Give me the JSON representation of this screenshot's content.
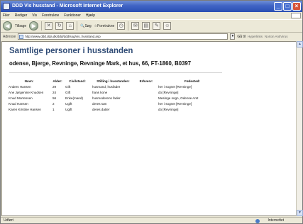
{
  "window": {
    "title": "DDD Vis husstand - Microsoft Internet Explorer"
  },
  "menu": {
    "items": [
      "Filer",
      "Rediger",
      "Vis",
      "Foretrukne",
      "Funktioner",
      "Hjælp"
    ]
  },
  "toolbar": {
    "back_label": "Tilbage",
    "search_label": "Søg",
    "favorites_label": "Foretrukne"
  },
  "address": {
    "label": "Adresse",
    "url": "http://www.ddd.dda.dk/ddd/ddd/sog/vis_husstand.asp",
    "go_label": "Gå til",
    "links_label": "Hyperlinks",
    "norton_label": "Norton AntiVirus"
  },
  "page": {
    "heading": "Samtlige personer i husstanden",
    "subheading": "odense, Bjerge, Revninge, Revninge Mark, et hus, 66, FT-1860, B0397"
  },
  "table": {
    "headers": [
      "Navn:",
      "Alder:",
      "Civilstand:",
      "Stilling i husstanden:",
      "Erhverv:",
      "Fødested:"
    ],
    "rows": [
      {
        "navn": "Anders Hansen",
        "alder": "29",
        "civil": "Gift",
        "stilling": "husmand, husfader",
        "erhverv": "",
        "fodested": "her i sognet [Revninge]"
      },
      {
        "navn": "Ane Jørgenine Knudsen",
        "alder": "24",
        "civil": "Gift",
        "stilling": "hans kone",
        "erhverv": "",
        "fodested": "do [Revninge]"
      },
      {
        "navn": "Knud Mortensen",
        "alder": "56",
        "civil": "Enke(mand)",
        "stilling": "husmoderens fader",
        "erhverv": "",
        "fodested": "Mesinge sogn, Odense Amt"
      },
      {
        "navn": "Knud Hansen",
        "alder": "2",
        "civil": "Ugift",
        "stilling": "deres søn",
        "erhverv": "",
        "fodested": "her i sognet [Revninge]"
      },
      {
        "navn": "Karen Kirstine Hansen",
        "alder": "1",
        "civil": "Ugift",
        "stilling": "deres datter",
        "erhverv": "",
        "fodested": "do [Revninge]"
      }
    ]
  },
  "status": {
    "left": "Udført",
    "zone": "Internettet"
  }
}
